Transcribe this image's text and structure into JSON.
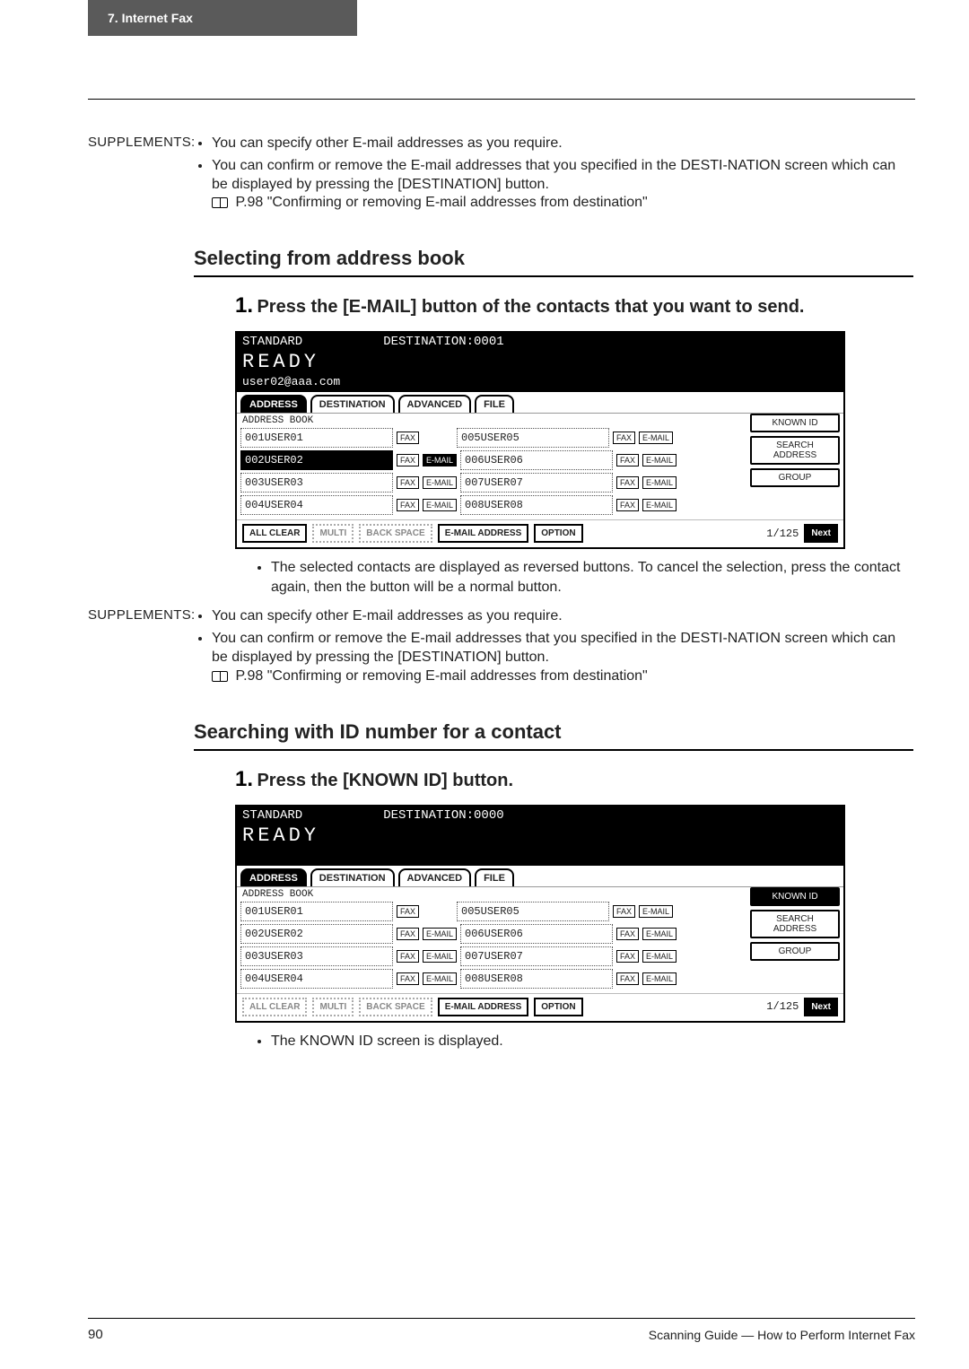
{
  "tab": "7. Internet Fax",
  "supp_label": "SUPPLEMENTS:",
  "supp1": {
    "b1": "You can specify other E-mail addresses as you require.",
    "b2": "You can confirm or remove the E-mail addresses that you specified in the DESTI-NATION screen which can be displayed by pressing the [DESTINATION] button.",
    "ref": "P.98 \"Confirming or removing E-mail addresses from destination\""
  },
  "sectionA": "Selecting from address book",
  "stepA": {
    "num": "1.",
    "text": "Press the [E-MAIL] button of the contacts that you want to send."
  },
  "scrA": {
    "std": "STANDARD",
    "dest": "DESTINATION:0001",
    "ready": "READY",
    "email": "user02@aaa.com",
    "tabs": [
      "ADDRESS",
      "DESTINATION",
      "ADVANCED",
      "FILE"
    ],
    "sub": "ADDRESS BOOK",
    "rows": [
      {
        "l": "001USER01",
        "r": "005USER05",
        "sel": false
      },
      {
        "l": "002USER02",
        "r": "006USER06",
        "sel": true
      },
      {
        "l": "003USER03",
        "r": "007USER07",
        "sel": false
      },
      {
        "l": "004USER04",
        "r": "008USER08",
        "sel": false
      }
    ],
    "fax": "FAX",
    "emailb": "E-MAIL",
    "right": [
      "KNOWN ID",
      "SEARCH ADDRESS",
      "GROUP"
    ],
    "bottom": {
      "all": "ALL CLEAR",
      "multi": "MULTI",
      "back": "BACK SPACE",
      "ea": "E-MAIL ADDRESS",
      "opt": "OPTION",
      "page": "1/125",
      "next": "Next"
    }
  },
  "noteA": "The selected contacts are displayed as reversed buttons.  To cancel the selection, press the contact again, then the button will be a normal button.",
  "supp2": {
    "b1": "You can specify other E-mail addresses as you require.",
    "b2": "You can confirm or remove the E-mail addresses that you specified in the DESTI-NATION screen which can be displayed by pressing the [DESTINATION] button.",
    "ref": "P.98 \"Confirming or removing E-mail addresses from destination\""
  },
  "sectionB": "Searching with ID number for a contact",
  "stepB": {
    "num": "1.",
    "text": "Press the [KNOWN ID] button."
  },
  "scrB": {
    "std": "STANDARD",
    "dest": "DESTINATION:0000",
    "ready": "READY",
    "email": "",
    "tabs": [
      "ADDRESS",
      "DESTINATION",
      "ADVANCED",
      "FILE"
    ],
    "sub": "ADDRESS BOOK",
    "rows": [
      {
        "l": "001USER01",
        "r": "005USER05"
      },
      {
        "l": "002USER02",
        "r": "006USER06"
      },
      {
        "l": "003USER03",
        "r": "007USER07"
      },
      {
        "l": "004USER04",
        "r": "008USER08"
      }
    ],
    "fax": "FAX",
    "emailb": "E-MAIL",
    "right": [
      "KNOWN ID",
      "SEARCH ADDRESS",
      "GROUP"
    ],
    "bottom": {
      "all": "ALL CLEAR",
      "multi": "MULTI",
      "back": "BACK SPACE",
      "ea": "E-MAIL ADDRESS",
      "opt": "OPTION",
      "page": "1/125",
      "next": "Next"
    }
  },
  "noteB": "The KNOWN ID screen is displayed.",
  "footer": {
    "page": "90",
    "title": "Scanning Guide — How to Perform Internet Fax"
  }
}
